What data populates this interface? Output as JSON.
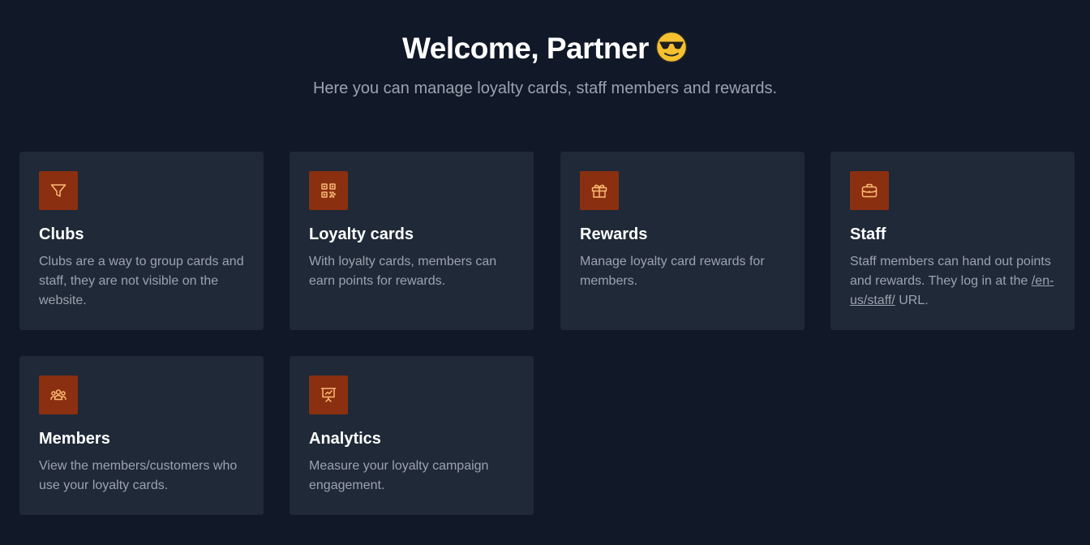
{
  "header": {
    "title": "Welcome, Partner",
    "subtitle": "Here you can manage loyalty cards, staff members and rewards."
  },
  "cards": [
    {
      "title": "Clubs",
      "description": "Clubs are a way to group cards and staff, they are not visible on the website.",
      "icon": "funnel-icon"
    },
    {
      "title": "Loyalty cards",
      "description": "With loyalty cards, members can earn points for rewards.",
      "icon": "qr-code-icon"
    },
    {
      "title": "Rewards",
      "description": "Manage loyalty card rewards for members.",
      "icon": "gift-icon"
    },
    {
      "title": "Staff",
      "description_before": "Staff members can hand out points and rewards. They log in at the",
      "link": "/en-us/staff/",
      "description_after": "URL.",
      "icon": "briefcase-icon"
    },
    {
      "title": "Members",
      "description": "View the members/customers who use your loyalty cards.",
      "icon": "user-group-icon"
    },
    {
      "title": "Analytics",
      "description": "Measure your loyalty campaign engagement.",
      "icon": "presentation-chart-icon"
    }
  ],
  "colors": {
    "background": "#111827",
    "card": "#1f2937",
    "icon_box": "#8a2f10",
    "icon_stroke": "#fdba74",
    "text_muted": "#9ca3af"
  }
}
